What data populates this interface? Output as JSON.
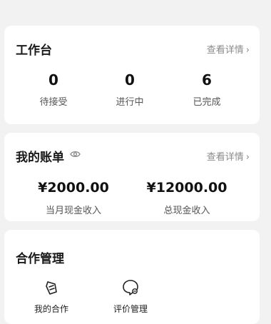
{
  "workbench": {
    "title": "工作台",
    "link": "查看详情",
    "stats": [
      {
        "value": "0",
        "label": "待接受"
      },
      {
        "value": "0",
        "label": "进行中"
      },
      {
        "value": "6",
        "label": "已完成"
      }
    ]
  },
  "bill": {
    "title": "我的账单",
    "link": "查看详情",
    "items": [
      {
        "amount": "¥2000.00",
        "label": "当月现金收入"
      },
      {
        "amount": "¥12000.00",
        "label": "总现金收入"
      }
    ]
  },
  "cooperation": {
    "title": "合作管理",
    "tools": [
      {
        "label": "我的合作",
        "icon": "cooperation-icon"
      },
      {
        "label": "评价管理",
        "icon": "review-icon"
      }
    ]
  }
}
